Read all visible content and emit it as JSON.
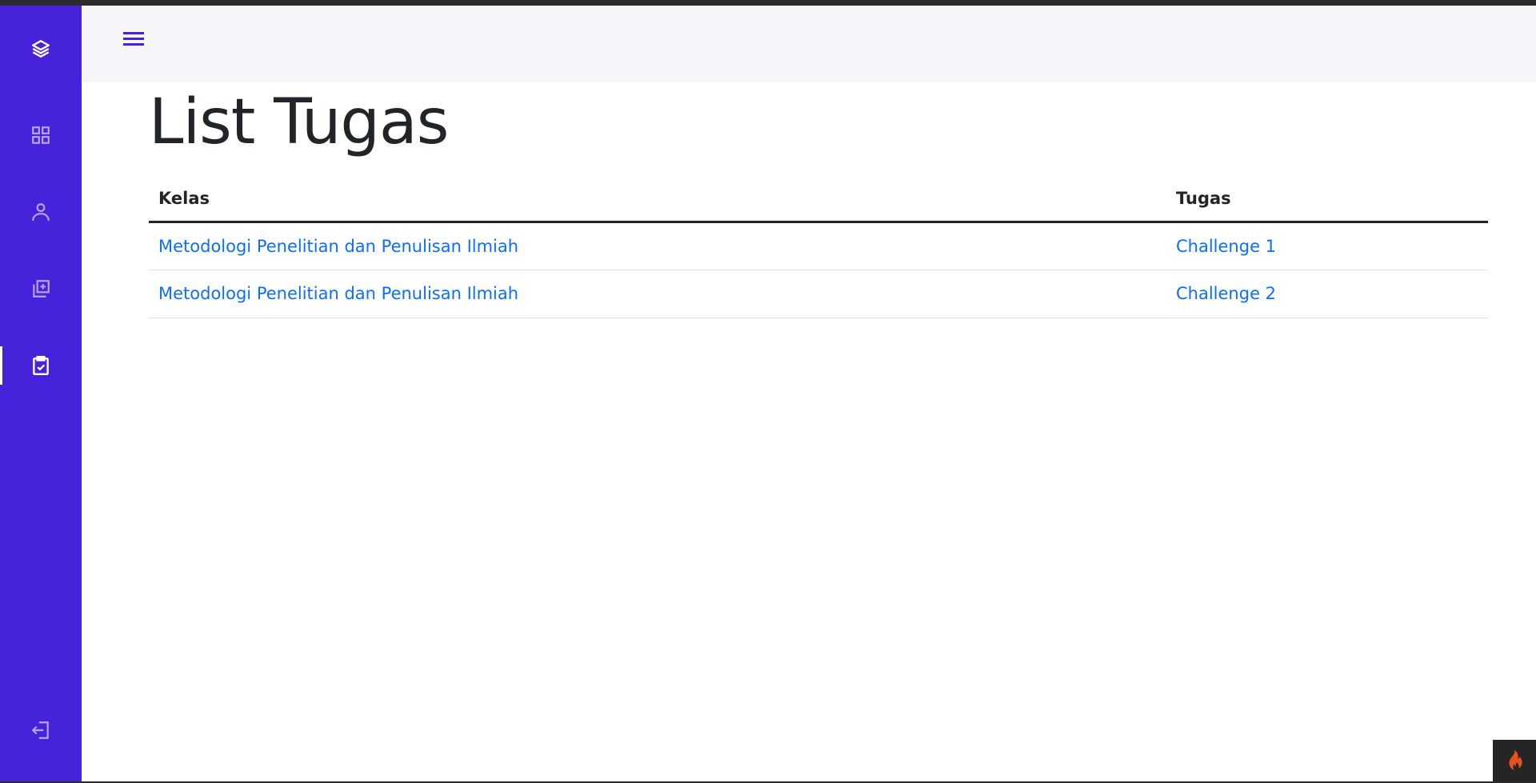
{
  "sidebar": {
    "items": [
      {
        "icon": "layers-icon",
        "label": "logo"
      },
      {
        "icon": "grid-icon",
        "label": "dashboard"
      },
      {
        "icon": "user-icon",
        "label": "profile"
      },
      {
        "icon": "add-collection-icon",
        "label": "add"
      },
      {
        "icon": "clipboard-check-icon",
        "label": "tasks",
        "active": true
      },
      {
        "icon": "logout-icon",
        "label": "logout"
      }
    ],
    "accent": "#4622da"
  },
  "page": {
    "title": "List Tugas"
  },
  "table": {
    "headers": [
      "Kelas",
      "Tugas"
    ],
    "rows": [
      [
        "Metodologi Penelitian dan Penulisan Ilmiah",
        "Challenge 1"
      ],
      [
        "Metodologi Penelitian dan Penulisan Ilmiah",
        "Challenge 2"
      ]
    ]
  },
  "colors": {
    "link": "#0d6efd",
    "text": "#212529"
  }
}
